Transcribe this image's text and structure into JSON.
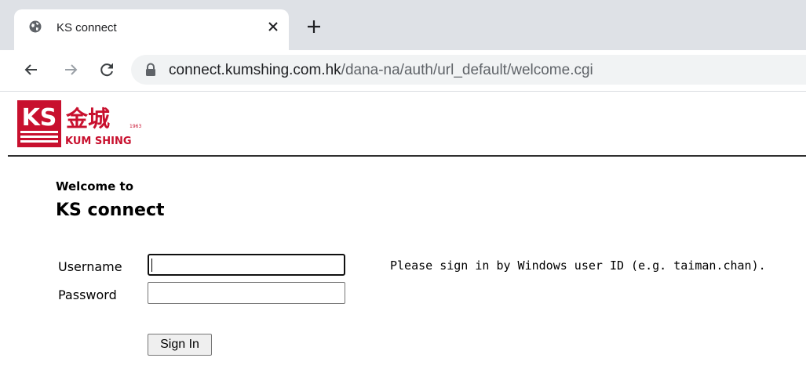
{
  "browser": {
    "tab": {
      "title": "KS connect",
      "favicon": "globe-icon"
    },
    "new_tab_icon": "plus-icon",
    "nav": {
      "back": "arrow-left-icon",
      "forward": "arrow-right-icon",
      "reload": "reload-icon"
    },
    "address": {
      "lock_icon": "lock-icon",
      "host": "connect.kumshing.com.hk",
      "path": "/dana-na/auth/url_default/welcome.cgi"
    }
  },
  "logo": {
    "mark": "KS",
    "chinese": "金城",
    "english": "KUM SHING",
    "year": "1963",
    "color": "#c8102e"
  },
  "page": {
    "welcome_small": "Welcome to",
    "welcome_big": "KS connect",
    "username_label": "Username",
    "password_label": "Password",
    "username_value": "",
    "password_value": "",
    "hint": "Please sign in by Windows user ID (e.g. taiman.chan).",
    "sign_in": "Sign In"
  }
}
